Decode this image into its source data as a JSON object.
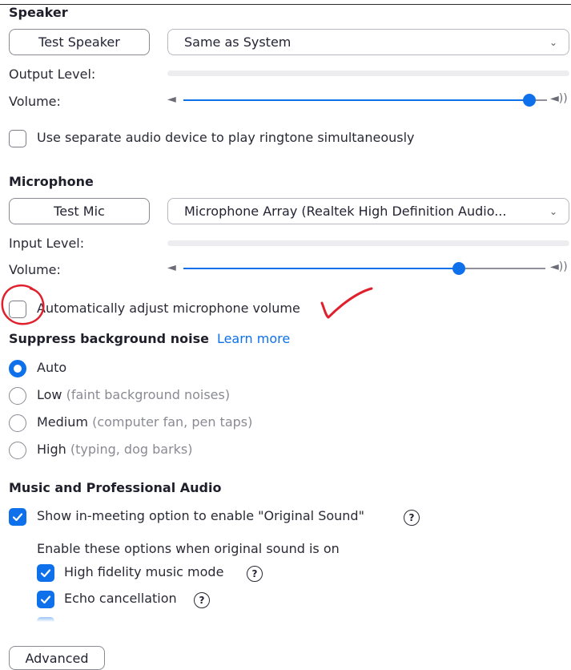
{
  "speaker": {
    "heading": "Speaker",
    "test_button": "Test Speaker",
    "device": "Same as System",
    "output_level_label": "Output Level:",
    "output_level": 0,
    "volume_label": "Volume:",
    "volume": 0.97
  },
  "ringtone": {
    "label": "Use separate audio device to play ringtone simultaneously",
    "checked": false
  },
  "microphone": {
    "heading": "Microphone",
    "test_button": "Test Mic",
    "device": "Microphone Array (Realtek High Definition Audio...",
    "input_level_label": "Input Level:",
    "input_level": 0,
    "volume_label": "Volume:",
    "volume": 0.76
  },
  "auto_adjust": {
    "label": "Automatically adjust microphone volume",
    "checked": false
  },
  "suppress": {
    "heading": "Suppress background noise",
    "learn_more": "Learn more",
    "options": [
      {
        "label": "Auto",
        "hint": "",
        "selected": true
      },
      {
        "label": "Low",
        "hint": "(faint background noises)",
        "selected": false
      },
      {
        "label": "Medium",
        "hint": "(computer fan, pen taps)",
        "selected": false
      },
      {
        "label": "High",
        "hint": "(typing, dog barks)",
        "selected": false
      }
    ]
  },
  "music": {
    "heading": "Music and Professional Audio",
    "original_sound_label": "Show in-meeting option to enable \"Original Sound\"",
    "original_sound_checked": true,
    "sub_heading": "Enable these options when original sound is on",
    "sub_options": [
      {
        "label": "High fidelity music mode",
        "checked": true
      },
      {
        "label": "Echo cancellation",
        "checked": true
      }
    ],
    "help_glyph": "?"
  },
  "advanced_button": "Advanced",
  "colors": {
    "accent": "#0e71eb",
    "annotation": "#e0202c"
  },
  "icons": [
    "chevron-down-icon",
    "speaker-low-icon",
    "speaker-high-icon",
    "check-icon",
    "help-icon"
  ]
}
